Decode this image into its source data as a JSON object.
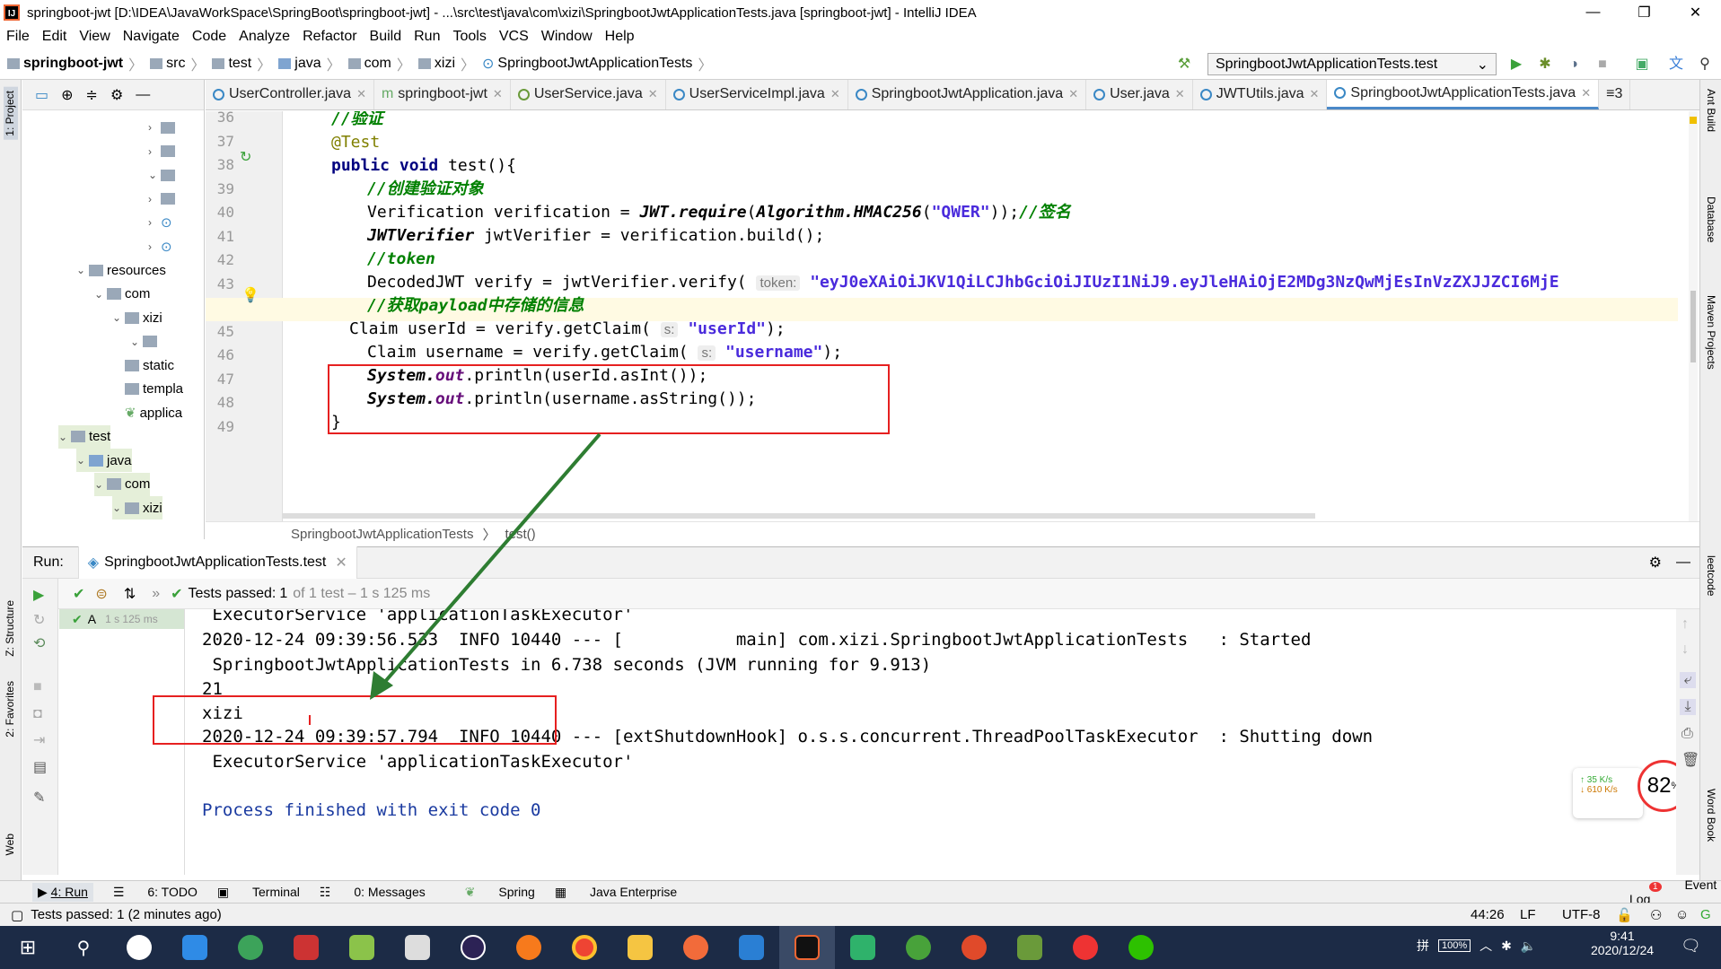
{
  "window": {
    "title": "springboot-jwt [D:\\IDEA\\JavaWorkSpace\\SpringBoot\\springboot-jwt] - ...\\src\\test\\java\\com\\xizi\\SpringbootJwtApplicationTests.java [springboot-jwt] - IntelliJ IDEA",
    "logo": "IJ"
  },
  "menu": [
    "File",
    "Edit",
    "View",
    "Navigate",
    "Code",
    "Analyze",
    "Refactor",
    "Build",
    "Run",
    "Tools",
    "VCS",
    "Window",
    "Help"
  ],
  "breadcrumb": [
    "springboot-jwt",
    "src",
    "test",
    "java",
    "com",
    "xizi",
    "SpringbootJwtApplicationTests"
  ],
  "run_config": "SpringbootJwtApplicationTests.test",
  "side_left": {
    "project": "1: Project",
    "structure": "Z: Structure",
    "favorites": "2: Favorites",
    "web": "Web"
  },
  "side_right": {
    "ant": "Ant Build",
    "database": "Database",
    "maven": "Maven Projects",
    "leetcode": "leetcode",
    "wordbook": "Word Book"
  },
  "tree": [
    {
      "indent": 0,
      "arrow": "›",
      "label": "",
      "icon": "folder"
    },
    {
      "indent": 0,
      "arrow": "›",
      "label": "",
      "icon": "folder"
    },
    {
      "indent": 0,
      "arrow": "⌄",
      "label": "",
      "icon": "folder"
    },
    {
      "indent": 0,
      "arrow": "›",
      "label": "",
      "icon": "folder"
    },
    {
      "indent": 0,
      "arrow": "›",
      "label": "",
      "icon": "class"
    },
    {
      "indent": 0,
      "arrow": "›",
      "label": "",
      "icon": "class"
    },
    {
      "indent": 1,
      "arrow": "⌄",
      "label": "resources",
      "icon": "folder"
    },
    {
      "indent": 2,
      "arrow": "⌄",
      "label": "com",
      "icon": "folder"
    },
    {
      "indent": 3,
      "arrow": "⌄",
      "label": "xizi",
      "icon": "folder"
    },
    {
      "indent": 4,
      "arrow": "⌄",
      "label": "",
      "icon": "folder"
    },
    {
      "indent": 3,
      "arrow": "",
      "label": "static",
      "icon": "folder"
    },
    {
      "indent": 3,
      "arrow": "",
      "label": "templa",
      "icon": "folder"
    },
    {
      "indent": 3,
      "arrow": "",
      "label": "applica",
      "icon": "spring"
    },
    {
      "indent": 0,
      "arrow": "⌄",
      "label": "test",
      "icon": "folder"
    },
    {
      "indent": 1,
      "arrow": "⌄",
      "label": "java",
      "icon": "src"
    },
    {
      "indent": 2,
      "arrow": "⌄",
      "label": "com",
      "icon": "folder"
    },
    {
      "indent": 3,
      "arrow": "⌄",
      "label": "xizi",
      "icon": "folder"
    }
  ],
  "tabs": [
    {
      "label": "UserController.java",
      "icon": "c"
    },
    {
      "label": "springboot-jwt",
      "icon": "m"
    },
    {
      "label": "UserService.java",
      "icon": "i"
    },
    {
      "label": "UserServiceImpl.java",
      "icon": "c"
    },
    {
      "label": "SpringbootJwtApplication.java",
      "icon": "c"
    },
    {
      "label": "User.java",
      "icon": "c"
    },
    {
      "label": "JWTUtils.java",
      "icon": "c"
    },
    {
      "label": "SpringbootJwtApplicationTests.java",
      "icon": "c",
      "active": true
    }
  ],
  "tabs_overflow": "≡3",
  "code": {
    "lines": [
      "36",
      "37",
      "38",
      "39",
      "40",
      "41",
      "42",
      "43",
      "44",
      "45",
      "46",
      "47",
      "48",
      "49"
    ],
    "l36": "//验证",
    "l37": "@Test",
    "l38_kw1": "public",
    "l38_kw2": "void",
    "l38_rest": " test(){",
    "l39": "//创建验证对象",
    "l40_a": "Verification verification = ",
    "l40_b": "JWT.require",
    "l40_c": "(",
    "l40_d": "Algorithm.HMAC256",
    "l40_e": "(",
    "l40_f": "\"QWER\"",
    "l40_g": "));",
    "l40_h": "//签名",
    "l41_a": "JWTVerifier",
    "l41_b": " jwtVerifier = verification.build();",
    "l42": "//token",
    "l43_a": "DecodedJWT verify = jwtVerifier.verify(",
    "l43_hint": "token:",
    "l43_str": "\"eyJ0eXAiOiJKV1QiLCJhbGciOiJIUzI1NiJ9.eyJleHAiOjE2MDg3NzQwMjEsInVzZXJJZCI6MjE",
    "l44": "//获取payload中存储的信息",
    "l45_a": "Claim userId = verify.getClaim(",
    "l45_hint": "s:",
    "l45_str": "\"userId\"",
    "l45_b": ");",
    "l46_a": "Claim username = verify.getClaim(",
    "l46_hint": "s:",
    "l46_str": "\"username\"",
    "l46_b": ");",
    "l47_a": "System.",
    "l47_b": "out",
    "l47_c": ".println(userId.asInt());",
    "l48_a": "System.",
    "l48_b": "out",
    "l48_c": ".println(username.asString());",
    "l49": "}"
  },
  "editor_breadcrumb": [
    "SpringbootJwtApplicationTests",
    "test()"
  ],
  "run": {
    "label": "Run:",
    "tab": "SpringbootJwtApplicationTests.test",
    "status_prefix": "Tests passed:",
    "status_count": "1",
    "status_rest": "of 1 test – 1 s 125 ms",
    "tree_item": "A",
    "tree_time": "1 s 125 ms"
  },
  "console": [
    " ExecutorService 'applicationTaskExecutor'",
    "2020-12-24 09:39:56.533  INFO 10440 --- [           main] com.xizi.SpringbootJwtApplicationTests   : Started",
    " SpringbootJwtApplicationTests in 6.738 seconds (JVM running for 9.913)",
    "21",
    "xizi",
    "2020-12-24 09:39:57.794  INFO 10440 --- [extShutdownHook] o.s.s.concurrent.ThreadPoolTaskExecutor  : Shutting down",
    " ExecutorService 'applicationTaskExecutor'",
    "",
    "Process finished with exit code 0"
  ],
  "netspeed": {
    "up": "35  K/s",
    "down": "610 K/s",
    "percent": "82",
    "percent_unit": "%"
  },
  "bottom_tabs": [
    "4: Run",
    "6: TODO",
    "Terminal",
    "0: Messages",
    "Spring",
    "Java Enterprise"
  ],
  "event_log": "Event Log",
  "event_count": "1",
  "status": {
    "left": "Tests passed: 1 (2 minutes ago)",
    "pos": "44:26",
    "lf": "LF",
    "enc": "UTF-8"
  },
  "clock": {
    "time": "9:41",
    "date": "2020/12/24"
  },
  "battery": "100%",
  "colors": {
    "taskbar": "#1c2b46",
    "highlight": "#e62020",
    "arrow": "#2e7d32"
  }
}
